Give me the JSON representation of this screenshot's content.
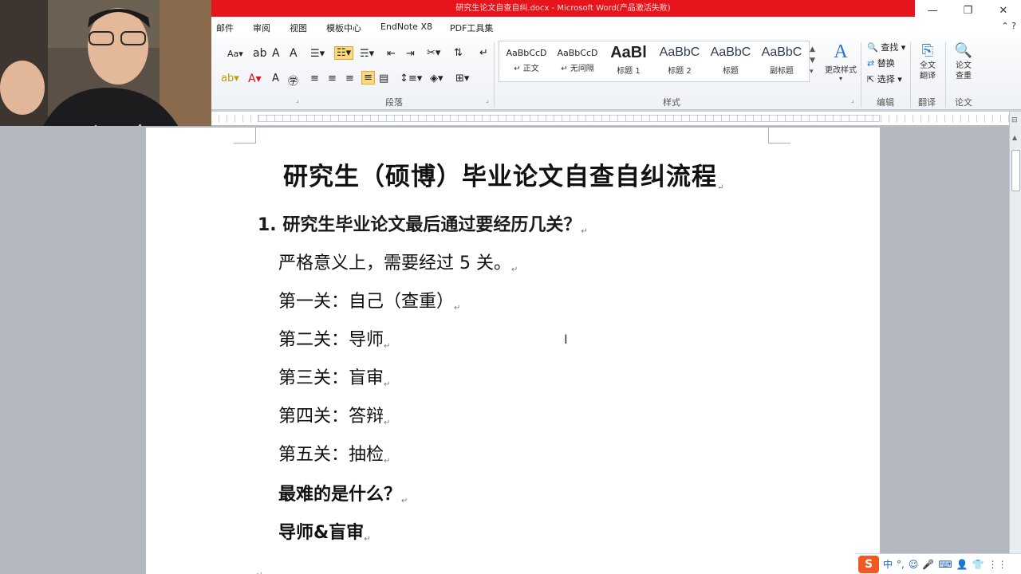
{
  "window": {
    "title": "研究生论文自查自纠.docx - Microsoft Word(产品激活失败)",
    "controls": [
      "—",
      "❐",
      "✕"
    ]
  },
  "tabs": [
    "邮件",
    "审阅",
    "视图",
    "模板中心",
    "EndNote X8",
    "PDF工具集"
  ],
  "ribbon": {
    "groups": [
      "段落",
      "样式",
      "编辑",
      "翻译",
      "论文"
    ],
    "font_case": "Aa",
    "styles": [
      {
        "sample": "AaBbCcD",
        "name": "正文"
      },
      {
        "sample": "AaBbCcD",
        "name": "无间隔"
      },
      {
        "sample": "AaBl",
        "name": "标题 1"
      },
      {
        "sample": "AaBbC",
        "name": "标题 2"
      },
      {
        "sample": "AaBbC",
        "name": "标题"
      },
      {
        "sample": "AaBbC",
        "name": "副标题"
      }
    ],
    "change_styles": "更改样式",
    "edit": {
      "find": "查找",
      "replace": "替换",
      "select": "选择"
    },
    "translate": "全文翻译",
    "paper_check": "论文查重"
  },
  "document": {
    "title": "研究生（硕博）毕业论文自查自纠流程",
    "question": "1. 研究生毕业论文最后通过要经历几关？",
    "lines": [
      "严格意义上，需要经过 5 关。",
      "第一关：自己（查重）",
      "第二关：导师",
      "第三关：盲审",
      "第四关：答辩",
      "第五关：抽检"
    ],
    "bold_lines": [
      "最难的是什么？",
      "导师&盲审"
    ],
    "paragraph_mark": "↵"
  },
  "tray": {
    "logo": "S",
    "items": [
      "中",
      "°,",
      "☺",
      "🎤",
      "⌨",
      "👤",
      "👕",
      "⋮⋮"
    ]
  },
  "colors": {
    "titlebar": "#e8141c",
    "ribbon": "#eef1f6",
    "page": "#ffffff",
    "canvas": "#b3b8c1"
  }
}
